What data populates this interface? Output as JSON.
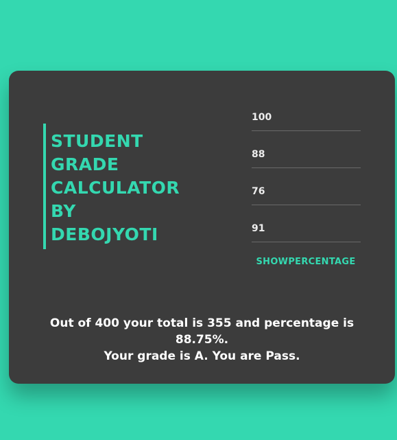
{
  "title": {
    "lines": [
      "STUDENT",
      "GRADE",
      "CALCULATOR",
      "BY",
      "DEBOJYOTI"
    ]
  },
  "inputs": {
    "marks": [
      "100",
      "88",
      "76",
      "91"
    ]
  },
  "actions": {
    "show_percentage_label": "SHOWPERCENTAGE"
  },
  "result": {
    "line1": "Out of 400 your total is 355 and percentage is 88.75%.",
    "line2": "Your grade is A. You are Pass."
  },
  "colors": {
    "background": "#34d8b0",
    "card": "#3c3c3c",
    "accent": "#34d8b0",
    "text": "#ffffff"
  }
}
